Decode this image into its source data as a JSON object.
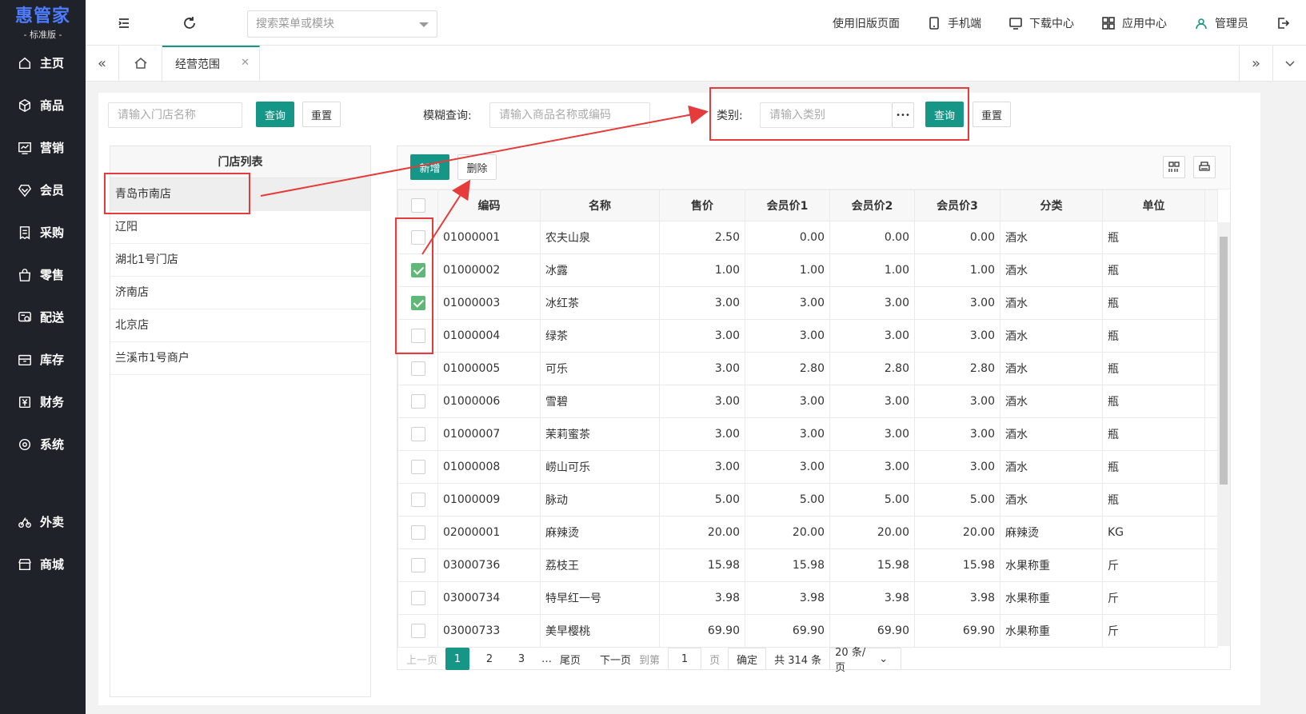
{
  "brand": {
    "name": "惠管家",
    "edition": "- 标准版 -"
  },
  "sidebar": {
    "items": [
      {
        "label": "主页",
        "icon": "home-icon"
      },
      {
        "label": "商品",
        "icon": "cube-icon"
      },
      {
        "label": "营销",
        "icon": "chart-icon"
      },
      {
        "label": "会员",
        "icon": "diamond-icon"
      },
      {
        "label": "采购",
        "icon": "receipt-icon"
      },
      {
        "label": "零售",
        "icon": "bag-icon"
      },
      {
        "label": "配送",
        "icon": "truck-icon"
      },
      {
        "label": "库存",
        "icon": "box-icon"
      },
      {
        "label": "财务",
        "icon": "yen-icon"
      },
      {
        "label": "系统",
        "icon": "gear-icon"
      }
    ],
    "extra_items": [
      {
        "label": "外卖",
        "icon": "bike-icon"
      },
      {
        "label": "商城",
        "icon": "shop-icon"
      }
    ]
  },
  "topbar": {
    "search_placeholder": "搜索菜单或模块",
    "links": {
      "old_version": "使用旧版页面",
      "mobile": "手机端",
      "download": "下载中心",
      "apps": "应用中心",
      "user": "管理员"
    }
  },
  "tabs": {
    "active": "经营范围"
  },
  "filters": {
    "store_placeholder": "请输入门店名称",
    "query_label": "查询",
    "reset_label": "重置",
    "fuzzy_label": "模糊查询:",
    "fuzzy_placeholder": "请输入商品名称或编码",
    "category_label": "类别:",
    "category_placeholder": "请输入类别",
    "more_label": "•••"
  },
  "stores": {
    "header": "门店列表",
    "items": [
      "青岛市南店",
      "辽阳",
      "湖北1号门店",
      "济南店",
      "北京店",
      "兰溪市1号商户"
    ],
    "selected": 0
  },
  "grid": {
    "add_label": "新增",
    "delete_label": "删除",
    "columns": [
      "编码",
      "名称",
      "售价",
      "会员价1",
      "会员价2",
      "会员价3",
      "分类",
      "单位"
    ],
    "rows": [
      {
        "checked": false,
        "cells": [
          "01000001",
          "农夫山泉",
          "2.50",
          "0.00",
          "0.00",
          "0.00",
          "酒水",
          "瓶"
        ]
      },
      {
        "checked": true,
        "cells": [
          "01000002",
          "冰露",
          "1.00",
          "1.00",
          "1.00",
          "1.00",
          "酒水",
          "瓶"
        ]
      },
      {
        "checked": true,
        "cells": [
          "01000003",
          "冰红茶",
          "3.00",
          "3.00",
          "3.00",
          "3.00",
          "酒水",
          "瓶"
        ]
      },
      {
        "checked": false,
        "cells": [
          "01000004",
          "绿茶",
          "3.00",
          "3.00",
          "3.00",
          "3.00",
          "酒水",
          "瓶"
        ]
      },
      {
        "checked": false,
        "cells": [
          "01000005",
          "可乐",
          "3.00",
          "2.80",
          "2.80",
          "2.80",
          "酒水",
          "瓶"
        ]
      },
      {
        "checked": false,
        "cells": [
          "01000006",
          "雪碧",
          "3.00",
          "3.00",
          "3.00",
          "3.00",
          "酒水",
          "瓶"
        ]
      },
      {
        "checked": false,
        "cells": [
          "01000007",
          "茉莉蜜茶",
          "3.00",
          "3.00",
          "3.00",
          "3.00",
          "酒水",
          "瓶"
        ]
      },
      {
        "checked": false,
        "cells": [
          "01000008",
          "崂山可乐",
          "3.00",
          "3.00",
          "3.00",
          "3.00",
          "酒水",
          "瓶"
        ]
      },
      {
        "checked": false,
        "cells": [
          "01000009",
          "脉动",
          "5.00",
          "5.00",
          "5.00",
          "5.00",
          "酒水",
          "瓶"
        ]
      },
      {
        "checked": false,
        "cells": [
          "02000001",
          "麻辣烫",
          "20.00",
          "20.00",
          "20.00",
          "20.00",
          "麻辣烫",
          "KG"
        ]
      },
      {
        "checked": false,
        "cells": [
          "03000736",
          "荔枝王",
          "15.98",
          "15.98",
          "15.98",
          "15.98",
          "水果称重",
          "斤"
        ]
      },
      {
        "checked": false,
        "cells": [
          "03000734",
          "特早红一号",
          "3.98",
          "3.98",
          "3.98",
          "3.98",
          "水果称重",
          "斤"
        ]
      },
      {
        "checked": false,
        "cells": [
          "03000733",
          "美早樱桃",
          "69.90",
          "69.90",
          "69.90",
          "69.90",
          "水果称重",
          "斤"
        ]
      }
    ]
  },
  "pager": {
    "prev": "上一页",
    "pages": [
      "1",
      "2",
      "3"
    ],
    "ellipsis": "…",
    "last": "尾页",
    "next": "下一页",
    "goto": "到第",
    "page_value": "1",
    "page_unit": "页",
    "confirm": "确定",
    "total": "共 314 条",
    "page_size": "20 条/页"
  },
  "colors": {
    "primary": "#159687",
    "annotation": "#e63b3b",
    "sidebar_bg": "#1f2329"
  }
}
